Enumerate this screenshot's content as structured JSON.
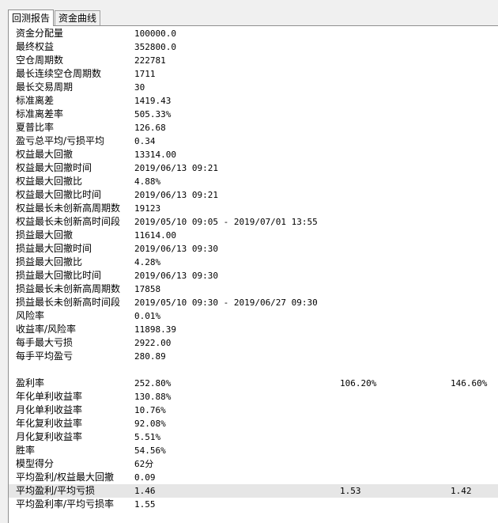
{
  "tabs": [
    {
      "label": "回测报告",
      "active": true
    },
    {
      "label": "资金曲线",
      "active": false
    }
  ],
  "rows": [
    {
      "label": "资金分配量",
      "v1": "100000.0"
    },
    {
      "label": "最终权益",
      "v1": "352800.0"
    },
    {
      "label": "空仓周期数",
      "v1": "222781"
    },
    {
      "label": "最长连续空仓周期数",
      "v1": "1711"
    },
    {
      "label": "最长交易周期",
      "v1": "30"
    },
    {
      "label": "标准离差",
      "v1": "1419.43"
    },
    {
      "label": "标准离差率",
      "v1": "505.33%"
    },
    {
      "label": "夏普比率",
      "v1": "126.68"
    },
    {
      "label": "盈亏总平均/亏损平均",
      "v1": "0.34"
    },
    {
      "label": "权益最大回撤",
      "v1": "13314.00"
    },
    {
      "label": "权益最大回撤时间",
      "v1": "2019/06/13 09:21"
    },
    {
      "label": "权益最大回撤比",
      "v1": "4.88%"
    },
    {
      "label": "权益最大回撤比时间",
      "v1": "2019/06/13 09:21"
    },
    {
      "label": "权益最长未创新高周期数",
      "v1": "19123"
    },
    {
      "label": "权益最长未创新高时间段",
      "v1": "2019/05/10 09:05 - 2019/07/01 13:55"
    },
    {
      "label": "损益最大回撤",
      "v1": "11614.00"
    },
    {
      "label": "损益最大回撤时间",
      "v1": "2019/06/13 09:30"
    },
    {
      "label": "损益最大回撤比",
      "v1": "4.28%"
    },
    {
      "label": "损益最大回撤比时间",
      "v1": "2019/06/13 09:30"
    },
    {
      "label": "损益最长未创新高周期数",
      "v1": "17858"
    },
    {
      "label": "损益最长未创新高时间段",
      "v1": "2019/05/10 09:30 - 2019/06/27 09:30"
    },
    {
      "label": "风险率",
      "v1": "0.01%"
    },
    {
      "label": "收益率/风险率",
      "v1": "11898.39"
    },
    {
      "label": "每手最大亏损",
      "v1": "2922.00"
    },
    {
      "label": "每手平均盈亏",
      "v1": "280.89"
    },
    {
      "label": "",
      "v1": ""
    },
    {
      "label": "盈利率",
      "v1": "252.80%",
      "v2": "106.20%",
      "v3": "146.60%"
    },
    {
      "label": "年化单利收益率",
      "v1": "130.88%"
    },
    {
      "label": "月化单利收益率",
      "v1": "10.76%"
    },
    {
      "label": "年化复利收益率",
      "v1": "92.08%"
    },
    {
      "label": "月化复利收益率",
      "v1": "5.51%"
    },
    {
      "label": "胜率",
      "v1": "54.56%"
    },
    {
      "label": "模型得分",
      "v1": "62分"
    },
    {
      "label": "平均盈利/权益最大回撤",
      "v1": "0.09"
    },
    {
      "label": "平均盈利/平均亏损",
      "v1": "1.46",
      "v2": "1.53",
      "v3": "1.42",
      "highlight": true
    },
    {
      "label": "平均盈利率/平均亏损率",
      "v1": "1.55"
    }
  ]
}
